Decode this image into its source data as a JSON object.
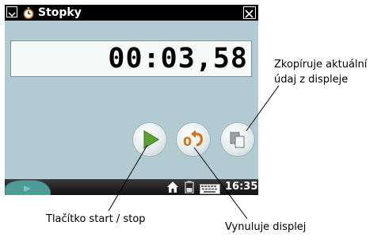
{
  "window": {
    "title": "Stopky",
    "menu_icon": "chevron-down-icon",
    "app_icon": "stopwatch-icon",
    "close_icon": "close-icon"
  },
  "display": {
    "value": "00:03,58"
  },
  "buttons": {
    "start_stop": {
      "icon": "play-icon"
    },
    "reset": {
      "icon": "reset-zero-icon",
      "glyph": "0"
    },
    "copy": {
      "icon": "copy-icon"
    }
  },
  "taskbar": {
    "clock": "16:35",
    "icons": [
      "start-menu-icon",
      "home-icon",
      "battery-icon",
      "keyboard-icon"
    ]
  },
  "annotations": {
    "copy_line1": "Zkopíruje aktuální",
    "copy_line2": "údaj z displeje",
    "start_stop": "Tlačítko start / stop",
    "reset": "Vynuluje displej"
  },
  "colors": {
    "screen_bg": "#b2cbd2",
    "play_green": "#5aa032",
    "reset_orange": "#d2741c",
    "title_bar": "#000000"
  }
}
